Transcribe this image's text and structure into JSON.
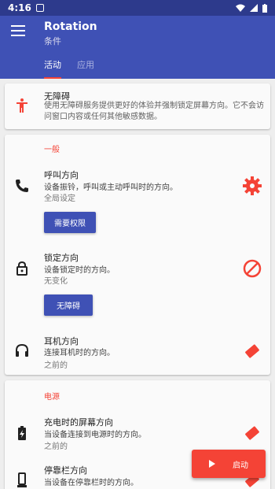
{
  "statusbar": {
    "time": "4:16",
    "notification_icon": "a-icon"
  },
  "appbar": {
    "title": "Rotation",
    "subtitle": "条件"
  },
  "tabs": [
    {
      "label": "活动",
      "active": true
    },
    {
      "label": "应用",
      "active": false
    }
  ],
  "accessibility_card": {
    "title": "无障碍",
    "desc": "使用无障碍服务提供更好的体验并强制锁定屏幕方向。它不会访问窗口内容或任何其他敏感数据。",
    "icon": "accessibility-icon"
  },
  "general": {
    "section_title": "一般",
    "call": {
      "title": "呼叫方向",
      "desc": "设备振铃，呼叫或主动呼叫时的方向。",
      "value": "全局设定",
      "button": "需要权限",
      "icon": "phone-icon",
      "right_icon": "gear-icon"
    },
    "lock": {
      "title": "锁定方向",
      "desc": "设备锁定时的方向。",
      "value": "无变化",
      "button": "无障碍",
      "icon": "lock-icon",
      "right_icon": "blocked-icon"
    },
    "headset": {
      "title": "耳机方向",
      "desc": "连接耳机时的方向。",
      "value": "之前的",
      "icon": "headset-icon",
      "right_icon": "rotate-icon"
    }
  },
  "power": {
    "section_title": "电源",
    "charging": {
      "title": "充电时的屏幕方向",
      "desc": "当设备连接到电源时的方向。",
      "value": "之前的",
      "icon": "battery-charging-icon",
      "right_icon": "rotate-icon"
    },
    "dock": {
      "title": "停靠栏方向",
      "desc": "当设备在停靠栏时的方向。",
      "icon": "dock-icon",
      "right_icon": "rotate-icon"
    }
  },
  "fab": {
    "label": "启动",
    "icon": "play-icon"
  },
  "colors": {
    "primary": "#3f51b5",
    "accent": "#f44336",
    "statusbar": "#2d3a8c"
  }
}
